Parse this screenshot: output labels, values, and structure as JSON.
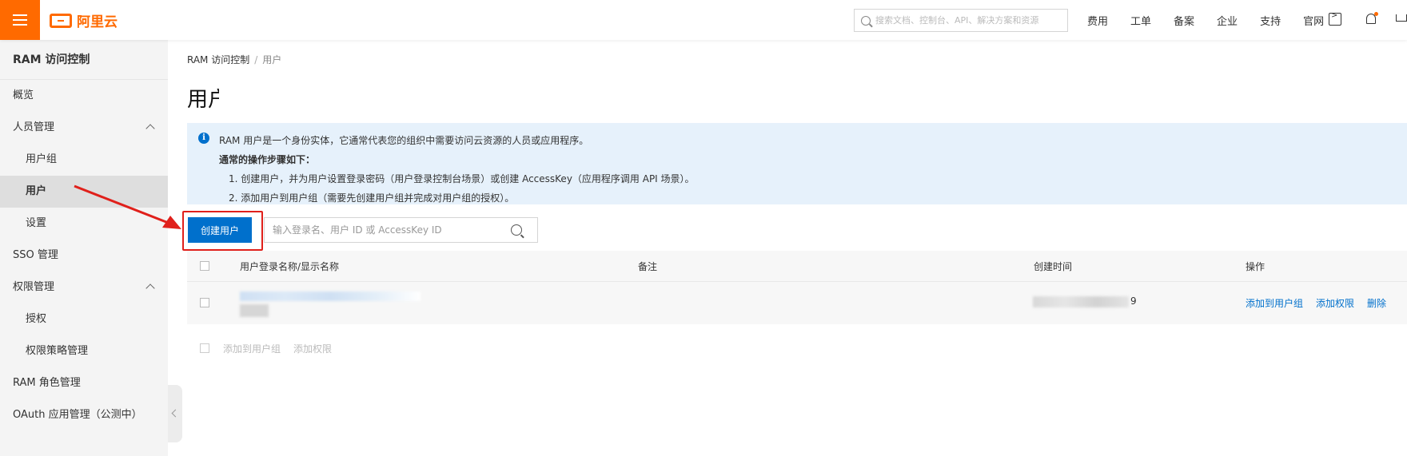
{
  "topbar": {
    "logo_text": "阿里云",
    "search_placeholder": "搜索文档、控制台、API、解决方案和资源",
    "nav": [
      "费用",
      "工单",
      "备案",
      "企业",
      "支持",
      "官网"
    ]
  },
  "sidebar": {
    "title": "RAM 访问控制",
    "items": [
      {
        "label": "概览"
      },
      {
        "label": "人员管理"
      },
      {
        "label": "用户组"
      },
      {
        "label": "用户"
      },
      {
        "label": "设置"
      },
      {
        "label": "SSO 管理"
      },
      {
        "label": "权限管理"
      },
      {
        "label": "授权"
      },
      {
        "label": "权限策略管理"
      },
      {
        "label": "RAM 角色管理"
      },
      {
        "label": "OAuth 应用管理（公测中）"
      }
    ]
  },
  "breadcrumb": {
    "root": "RAM 访问控制",
    "sep": "/",
    "current": "用户"
  },
  "page_title": "用户",
  "info": {
    "line1": "RAM 用户是一个身份实体，它通常代表您的组织中需要访问云资源的人员或应用程序。",
    "line2": "通常的操作步骤如下：",
    "step1": "1. 创建用户，并为用户设置登录密码（用户登录控制台场景）或创建 AccessKey（应用程序调用 API 场景）。",
    "step2": "2. 添加用户到用户组（需要先创建用户组并完成对用户组的授权）。"
  },
  "toolbar": {
    "create_label": "创建用户",
    "search_placeholder": "输入登录名、用户 ID 或 AccessKey ID"
  },
  "table": {
    "columns": [
      "用户登录名称/显示名称",
      "备注",
      "创建时间",
      "操作"
    ],
    "rows": [
      {
        "date_tail": "9",
        "actions": [
          "添加到用户组",
          "添加权限",
          "删除"
        ]
      }
    ]
  },
  "bulk_actions": [
    "添加到用户组",
    "添加权限"
  ],
  "colors": {
    "brand": "#ff6a00",
    "primary": "#0070cc",
    "highlight": "#e0201b"
  }
}
